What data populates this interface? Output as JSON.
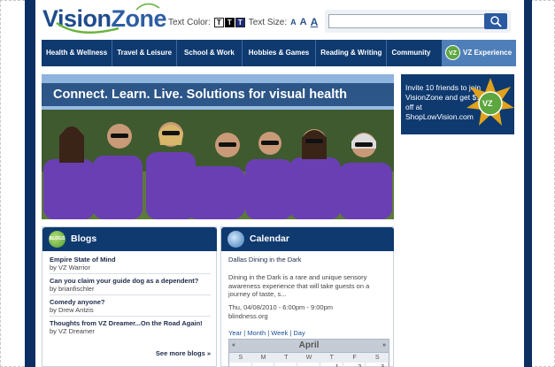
{
  "header": {
    "logo_text_1": "Vision",
    "logo_text_2": "Zone",
    "text_color_label": "Text Color:",
    "text_color_options": [
      "T",
      "T",
      "T"
    ],
    "text_size_label": "Text Size:",
    "text_size_options": [
      "A",
      "A",
      "A"
    ],
    "search_placeholder": ""
  },
  "nav": {
    "items": [
      "Health & Wellness",
      "Travel & Leisure",
      "School & Work",
      "Hobbies & Games",
      "Reading & Writing",
      "Community"
    ],
    "vz_label": "VZ Experience",
    "vz_badge": "VZ"
  },
  "hero": {
    "banner": "Connect. Learn. Live.  Solutions for visual health"
  },
  "promo": {
    "text": "Invite 10 friends to join VisionZone and get $10 off at ShopLowVision.com",
    "badge": "VZ"
  },
  "blogs": {
    "heading": "Blogs",
    "icon_label": "BLOGS",
    "items": [
      {
        "title": "Empire State of Mind",
        "by": "by VZ Warrior"
      },
      {
        "title": "Can you claim your guide dog as a dependent?",
        "by": "by brianfischler"
      },
      {
        "title": "Comedy anyone?",
        "by": "by Drew Antzis"
      },
      {
        "title": "Thoughts from VZ Dreamer...On the Road Again!",
        "by": "by VZ Dreamer"
      }
    ],
    "see_more": "See more blogs »"
  },
  "calendar": {
    "heading": "Calendar",
    "event_title": "Dallas Dining in the Dark",
    "event_desc": "Dining in the Dark is a rare and unique sensory awareness experience that will take guests on a journey of taste, s...",
    "event_time": "Thu, 04/08/2010 - 6:00pm - 9:00pm",
    "event_link": "blindness.org",
    "views": "Year | Month | Week | Day",
    "month": "April",
    "prev": "«",
    "next": "»",
    "weekdays": [
      "S",
      "M",
      "T",
      "W",
      "T",
      "F",
      "S"
    ],
    "first_row": [
      "",
      "",
      "",
      "",
      "1",
      "2",
      "3"
    ]
  },
  "colors": {
    "navy": "#0f3a70",
    "accent_green": "#5da640"
  }
}
